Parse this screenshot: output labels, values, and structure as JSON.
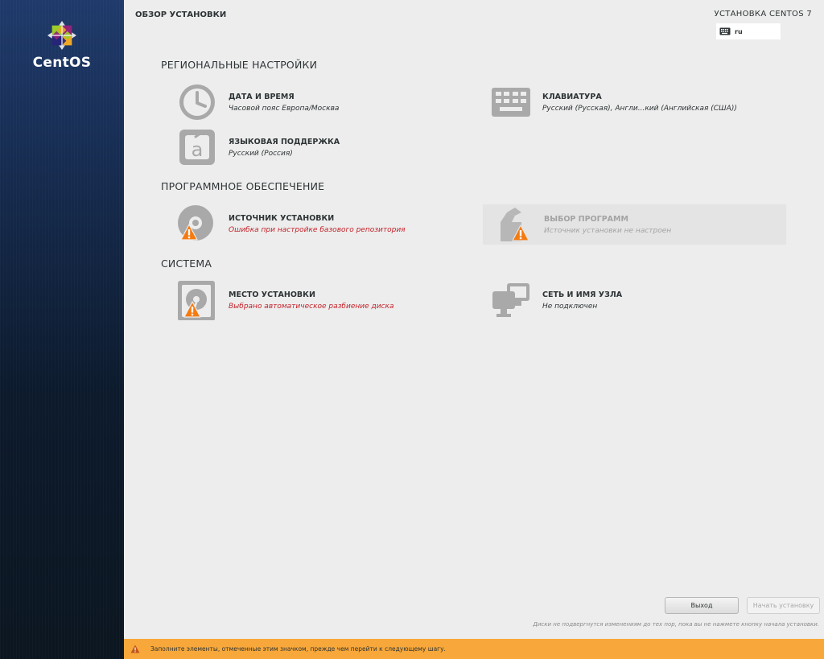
{
  "sidebar": {
    "logo_text": "CentOS"
  },
  "header": {
    "page_title": "ОБЗОР УСТАНОВКИ",
    "product_title": "УСТАНОВКА CENTOS 7",
    "keyboard_layout": "ru"
  },
  "sections": {
    "localization": {
      "title": "РЕГИОНАЛЬНЫЕ НАСТРОЙКИ",
      "date_time": {
        "label": "ДАТА И ВРЕМЯ",
        "status": "Часовой пояс Европа/Москва",
        "icon": "clock-icon"
      },
      "keyboard": {
        "label": "КЛАВИАТУРА",
        "status": "Русский (Русская), Англи...кий (Английская (США))",
        "icon": "keyboard-icon"
      },
      "language": {
        "label": "ЯЗЫКОВАЯ ПОДДЕРЖКА",
        "status": "Русский (Россия)",
        "icon": "language-icon"
      }
    },
    "software": {
      "title": "ПРОГРАММНОЕ ОБЕСПЕЧЕНИЕ",
      "source": {
        "label": "ИСТОЧНИК УСТАНОВКИ",
        "status": "Ошибка при настройке базового репозитория",
        "icon": "disc-icon",
        "warning": true
      },
      "selection": {
        "label": "ВЫБОР ПРОГРАММ",
        "status": "Источник установки не настроен",
        "icon": "package-icon",
        "warning": true,
        "disabled": true
      }
    },
    "system": {
      "title": "СИСТЕМА",
      "destination": {
        "label": "МЕСТО УСТАНОВКИ",
        "status": "Выбрано автоматическое разбиение диска",
        "icon": "harddisk-icon",
        "warning": true
      },
      "network": {
        "label": "СЕТЬ И ИМЯ УЗЛА",
        "status": "Не подключен",
        "icon": "network-icon"
      }
    }
  },
  "buttons": {
    "quit": "Выход",
    "begin": "Начать установку"
  },
  "footnote": "Диски не подвергнутся изменениям до тех пор, пока вы не нажмете кнопку начала установки.",
  "warning_bar": {
    "text": "Заполните элементы, отмеченные этим значком, прежде чем перейти к следующему шагу."
  },
  "colors": {
    "sidebar": "#1c3564",
    "warning": "#f8a83a",
    "error_text": "#c4232b",
    "icon_gray": "#a9a9a9"
  }
}
